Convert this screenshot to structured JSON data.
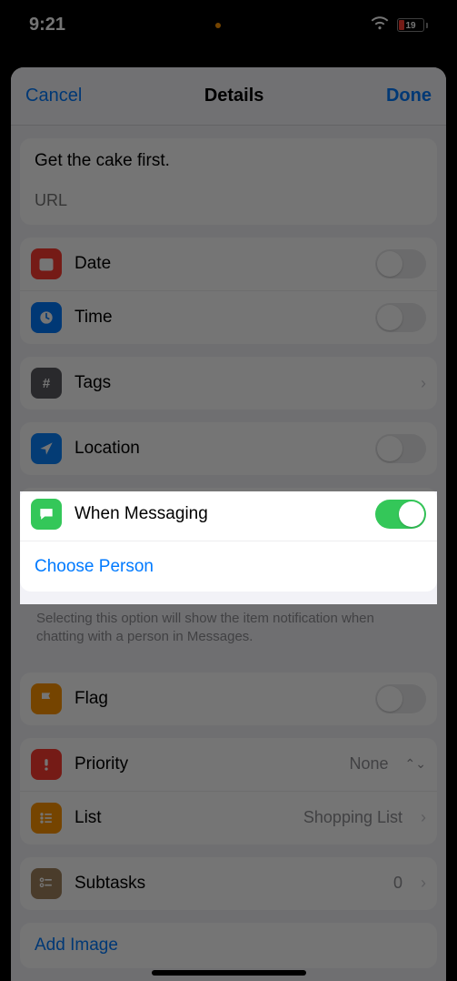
{
  "status": {
    "time": "9:21",
    "battery_pct": "19"
  },
  "nav": {
    "cancel": "Cancel",
    "title": "Details",
    "done": "Done"
  },
  "notes": {
    "text": "Get the cake first.",
    "url_placeholder": "URL"
  },
  "rows": {
    "date": "Date",
    "time": "Time",
    "tags": "Tags",
    "location": "Location",
    "messaging": "When Messaging",
    "choose_person": "Choose Person",
    "messaging_help": "Selecting this option will show the item notification when chatting with a person in Messages.",
    "flag": "Flag",
    "priority": "Priority",
    "priority_val": "None",
    "list": "List",
    "list_val": "Shopping List",
    "subtasks": "Subtasks",
    "subtasks_val": "0",
    "add_image": "Add Image"
  },
  "toggles": {
    "date": false,
    "time": false,
    "location": false,
    "messaging": true,
    "flag": false
  }
}
